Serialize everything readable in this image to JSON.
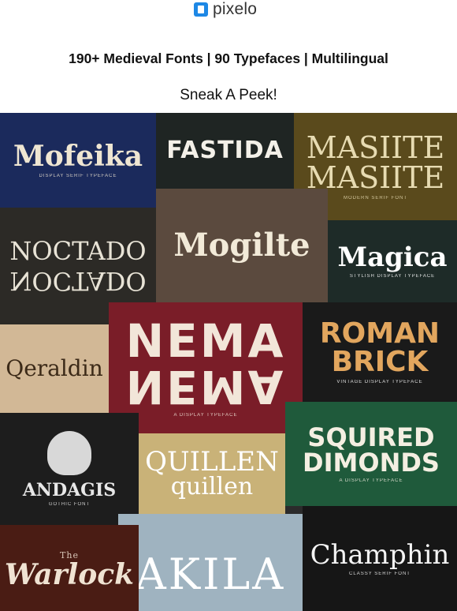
{
  "header": {
    "brand": "pixelo",
    "logo_icon": "pixelo-logo-icon",
    "accent": "#1e88e5"
  },
  "headline": "190+ Medieval Fonts | 90 Typefaces | Multilingual",
  "subhead": "Sneak A Peek!",
  "collage": {
    "tiles": [
      {
        "id": "mofeika",
        "name": "Mofeika",
        "tag": "Display Serif Typeface",
        "bg": "#1b2a5c",
        "fg": "#efe6d2"
      },
      {
        "id": "fastida",
        "name": "FASTIDA",
        "tag": "",
        "bg": "#1f2523",
        "fg": "#f3f0e8"
      },
      {
        "id": "masilte",
        "name": "MASIITE",
        "name2": "MASIITE",
        "tag": "Modern Serif Font",
        "bg": "#5a4a1c",
        "fg": "#e7dbb2"
      },
      {
        "id": "noctado",
        "name": "NOCTADO",
        "tag": "",
        "bg": "#2c2a26",
        "fg": "#e8e3d6"
      },
      {
        "id": "mogilte",
        "name": "Mogilte",
        "tag": "",
        "bg": "#5b4a3e",
        "fg": "#f2ead8"
      },
      {
        "id": "magica",
        "name": "Magica",
        "tag": "Stylish Display Typeface",
        "bg": "#1e2b28",
        "fg": "#ffffff"
      },
      {
        "id": "qeraldin",
        "name": "Qeraldin",
        "tag": "",
        "bg": "#d2b896",
        "fg": "#3c2a18"
      },
      {
        "id": "nema",
        "name": "NEMA",
        "tag": "A Display Typeface",
        "bg": "#7a1d28",
        "fg": "#f2e6d9"
      },
      {
        "id": "roman-brick",
        "name": "ROMAN",
        "name2": "BRICK",
        "tag": "Vintage Display Typeface",
        "bg": "#1a1a1a",
        "fg": "#e2a65e"
      },
      {
        "id": "andagis",
        "name": "ANDAGIS",
        "tag": "Gothic Font",
        "bg": "#1d1d1d",
        "fg": "#e8e8e8"
      },
      {
        "id": "quillen",
        "name": "QUILLEN",
        "name2": "quillen",
        "tag": "",
        "bg": "#c9b278",
        "fg": "#ffffff"
      },
      {
        "id": "squired",
        "name": "SQUIRED",
        "name2": "DIMONDS",
        "tag": "A Display Typeface",
        "bg": "#1f5a3b",
        "fg": "#f4efe2"
      },
      {
        "id": "warlock",
        "name": "Warlock",
        "tag": "The",
        "bg": "#4a1c14",
        "fg": "#f0e3d3"
      },
      {
        "id": "akila",
        "name": "AKILA",
        "tag": "",
        "bg": "#9fb3c0",
        "fg": "#ffffff"
      },
      {
        "id": "champhin",
        "name": "Champhin",
        "tag": "Classy Serif Font",
        "bg": "#161616",
        "fg": "#f4f4f4"
      }
    ]
  }
}
